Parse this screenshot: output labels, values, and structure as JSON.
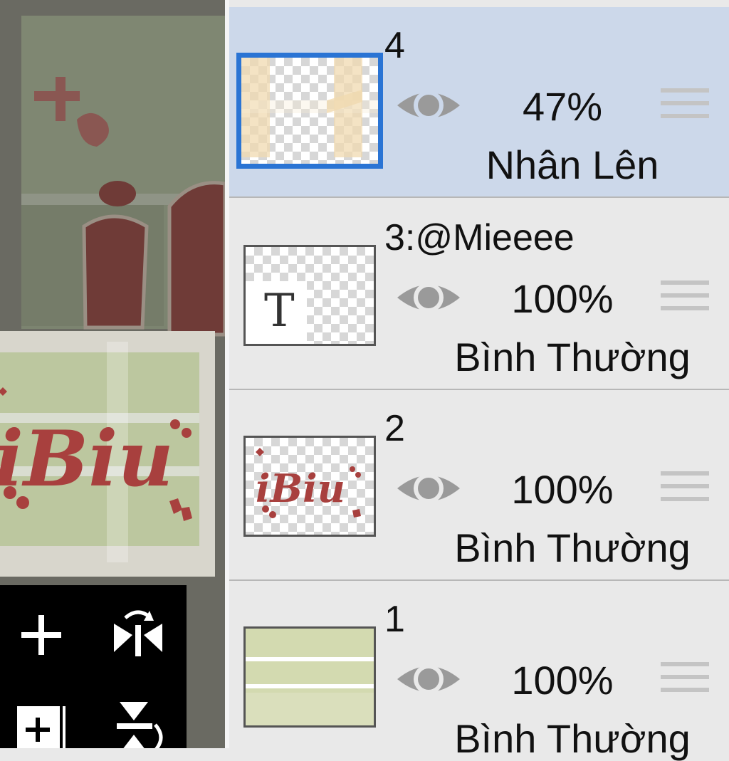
{
  "layers": [
    {
      "name": "4",
      "opacity": "47%",
      "blend": "Nhân Lên",
      "selected": true,
      "thumb_icon": "checker-light-thumbnail"
    },
    {
      "name": "3:@Mieeee",
      "opacity": "100%",
      "blend": "Bình Thường",
      "selected": false,
      "thumb_icon": "text-layer-thumbnail",
      "thumb_glyph": "T"
    },
    {
      "name": "2",
      "opacity": "100%",
      "blend": "Bình Thường",
      "selected": false,
      "thumb_icon": "artwork-thumbnail"
    },
    {
      "name": "1",
      "opacity": "100%",
      "blend": "Bình Thường",
      "selected": false,
      "thumb_icon": "background-thumbnail"
    }
  ],
  "toolbar": {
    "tools": [
      "add-layer-icon",
      "flip-horizontal-icon",
      "add-sublayer-icon",
      "flip-vertical-icon"
    ]
  },
  "colors": {
    "selected_row": "#ccd8ea",
    "row": "#e9e9e9",
    "selection_border": "#2a74d4",
    "eye": "#9a9a9a",
    "artwork_red": "#a8403e"
  }
}
